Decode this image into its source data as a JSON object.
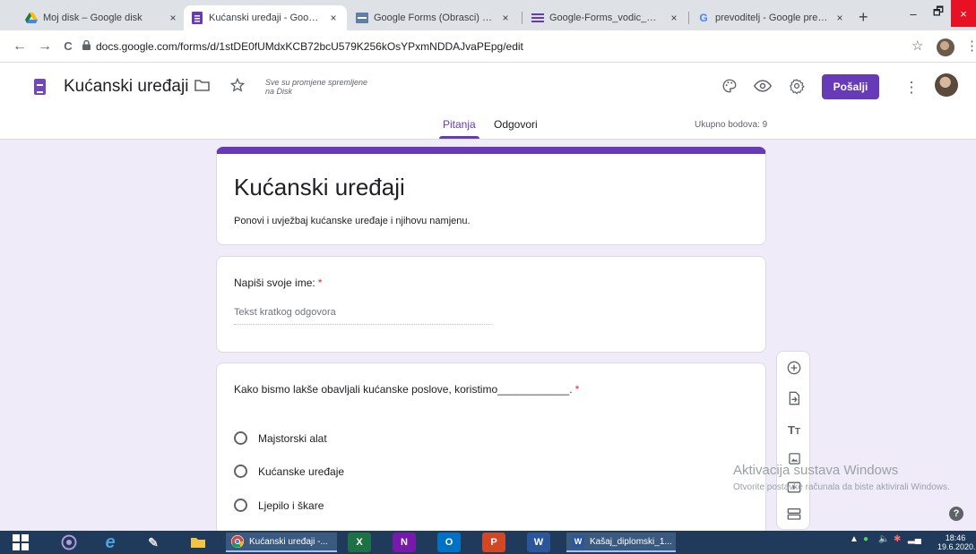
{
  "colors": {
    "brand": "#673ab7",
    "required": "#d93025",
    "background": "#f0ebf8"
  },
  "browser": {
    "tabs": [
      {
        "title": "Moj disk – Google disk",
        "icon": "google-drive-icon",
        "close": "×"
      },
      {
        "title": "Kućanski uređaji - Google obrasci",
        "icon": "google-forms-icon",
        "close": "×"
      },
      {
        "title": "Google Forms (Obrasci) - E-laboratorij",
        "icon": "elab-icon",
        "close": "×"
      },
      {
        "title": "Google-Forms_vodic_HR.pdf",
        "icon": "pdf-forms-icon",
        "close": "×"
      },
      {
        "title": "prevoditelj - Google pretraživanje",
        "icon": "google-icon",
        "close": "×"
      }
    ],
    "new_tab": "+",
    "window_controls": {
      "minimize": "–",
      "maximize": "🗗",
      "close": "×"
    },
    "url": "docs.google.com/forms/d/1stDE0fUMdxKCB72bcU579K256kOsYPxmNDDAJvaPEpg/edit",
    "nav": {
      "back": "←",
      "forward": "→",
      "reload": "C"
    },
    "bookmark_star": "☆",
    "menu": "⋮"
  },
  "header": {
    "title": "Kućanski uređaji",
    "saved_status": "Sve su promjene spremljene na Disk",
    "send_label": "Pošalji",
    "more": "⋮",
    "tabs": [
      {
        "label": "Pitanja"
      },
      {
        "label": "Odgovori"
      }
    ],
    "points": "Ukupno bodova: 9"
  },
  "form": {
    "title": "Kućanski uređaji",
    "description": "Ponovi i uvježbaj kućanske uređaje i njihovu namjenu."
  },
  "questions": [
    {
      "label": "Napiši svoje ime:",
      "required_mark": "*",
      "placeholder": "Tekst kratkog odgovora"
    },
    {
      "label": "Kako bismo lakše obavljali kućanske poslove, koristimo____________.",
      "required_mark": "*",
      "options": [
        "Majstorski alat",
        "Kućanske uređaje",
        "Ljepilo i škare"
      ]
    }
  ],
  "toolbar_icons": [
    "add-question-icon",
    "import-questions-icon",
    "add-title-icon",
    "add-image-icon",
    "add-video-icon",
    "add-section-icon"
  ],
  "windows_activation": {
    "title": "Aktivacija sustava Windows",
    "subtitle": "Otvorite postavke računala da biste aktivirali Windows."
  },
  "help": "?",
  "taskbar": {
    "tasks": [
      {
        "label": "Kućanski uređaji -..."
      },
      {
        "label": "Kašaj_diplomski_1..."
      }
    ],
    "time": "18:46",
    "date": "19.6.2020."
  }
}
